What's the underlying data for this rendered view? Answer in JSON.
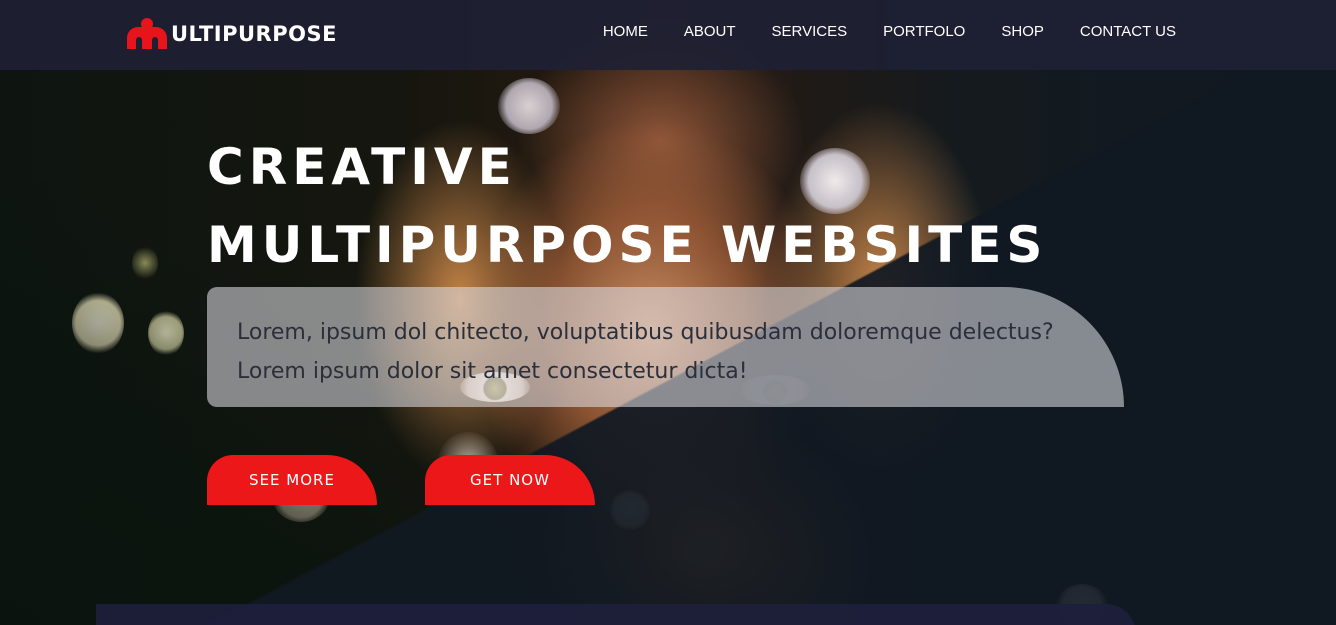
{
  "header": {
    "logo_text": "ULTIPURPOSE",
    "nav": [
      {
        "label": "HOME"
      },
      {
        "label": "ABOUT"
      },
      {
        "label": "SERVICES"
      },
      {
        "label": "PORTFOLO"
      },
      {
        "label": "SHOP"
      },
      {
        "label": "CONTACT US"
      }
    ]
  },
  "hero": {
    "title_line1": "CREATIVE",
    "title_line2": "MULTIPURPOSE WEBSITES",
    "text_line1": "Lorem, ipsum dol chitecto, voluptatibus quibusdam doloremque delectus?",
    "text_line2": "Lorem ipsum dolor sit amet consectetur dicta!",
    "buttons": {
      "see_more": "SEE MORE",
      "get_now": "GET NOW"
    }
  },
  "colors": {
    "accent": "#ec1719",
    "header_bg": "#1e2034",
    "text_light": "#ffffff"
  },
  "icons": {
    "logo": "logo-icon"
  }
}
